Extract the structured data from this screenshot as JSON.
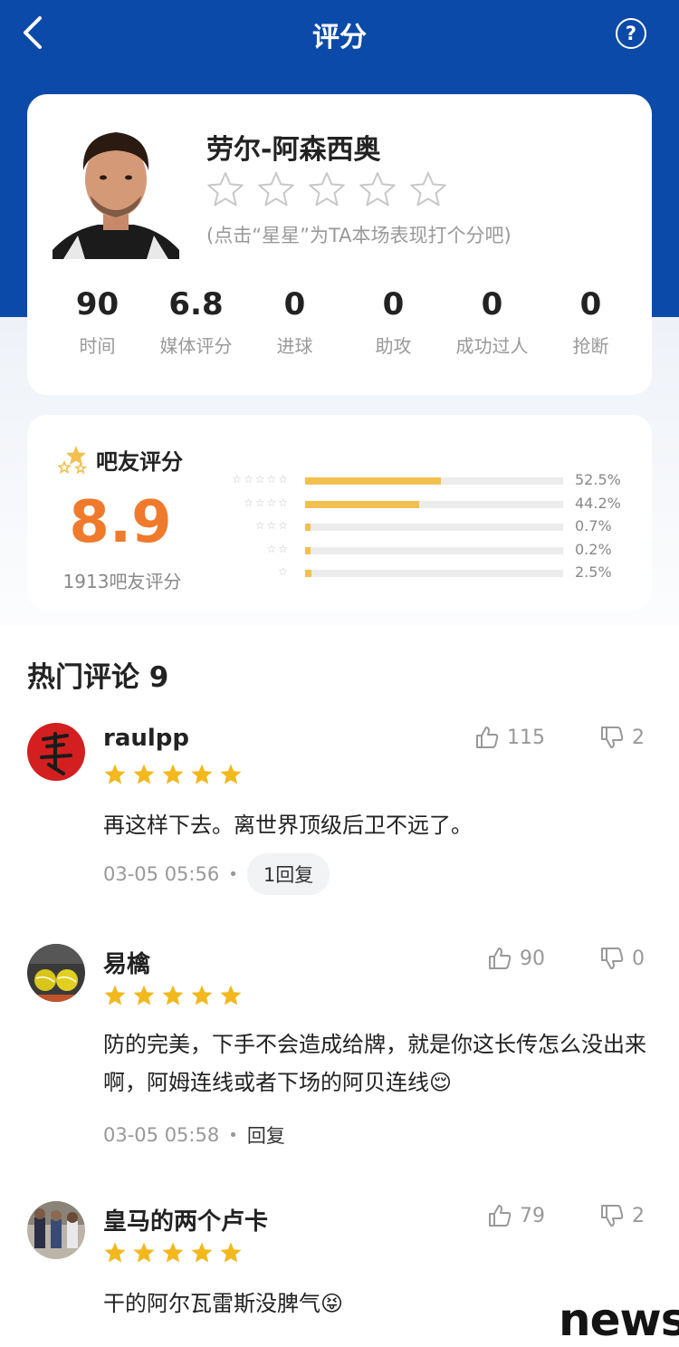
{
  "header": {
    "title": "评分",
    "back_icon": "chevron-left-icon",
    "help_icon": "question-circle-icon",
    "help_symbol": "?",
    "bg_color": "#0b4aa8"
  },
  "player": {
    "name": "劳尔-阿森西奥",
    "rate_hint": "(点击“星星”为TA本场表现打个分吧)",
    "stats": [
      {
        "value": "90",
        "label": "时间"
      },
      {
        "value": "6.8",
        "label": "媒体评分"
      },
      {
        "value": "0",
        "label": "进球"
      },
      {
        "value": "0",
        "label": "助攻"
      },
      {
        "value": "0",
        "label": "成功过人"
      },
      {
        "value": "0",
        "label": "抢断"
      }
    ]
  },
  "fan_rating": {
    "title": "吧友评分",
    "score": "8.9",
    "count_text": "1913吧友评分",
    "score_color": "#f07a2c",
    "bar_color": "#f2c04f",
    "distribution": [
      {
        "stars": "☆☆☆☆☆",
        "fraction": 0.525,
        "percent": "52.5%"
      },
      {
        "stars": "☆☆☆☆",
        "fraction": 0.442,
        "percent": "44.2%"
      },
      {
        "stars": "☆☆☆",
        "fraction": 0.007,
        "percent": "0.7%"
      },
      {
        "stars": "☆☆",
        "fraction": 0.002,
        "percent": "0.2%"
      },
      {
        "stars": "☆",
        "fraction": 0.025,
        "percent": "2.5%"
      }
    ]
  },
  "comments_section": {
    "title": "热门评论 9"
  },
  "comments": [
    {
      "user": "raulpp",
      "likes": "115",
      "dislikes": "2",
      "rating": 5,
      "text": "再这样下去。离世界顶级后卫不远了。",
      "time": "03-05 05:56",
      "reply": "1回复"
    },
    {
      "user": "易檎",
      "likes": "90",
      "dislikes": "0",
      "rating": 5,
      "text": "防的完美，下手不会造成给牌，就是你这长传怎么没出来啊，阿姆连线或者下场的阿贝连线😌",
      "time": "03-05 05:58",
      "reply": "回复"
    },
    {
      "user": "皇马的两个卢卡",
      "likes": "79",
      "dislikes": "2",
      "rating": 5,
      "text": "干的阿尔瓦雷斯没脾气😝"
    }
  ],
  "watermark": "news"
}
